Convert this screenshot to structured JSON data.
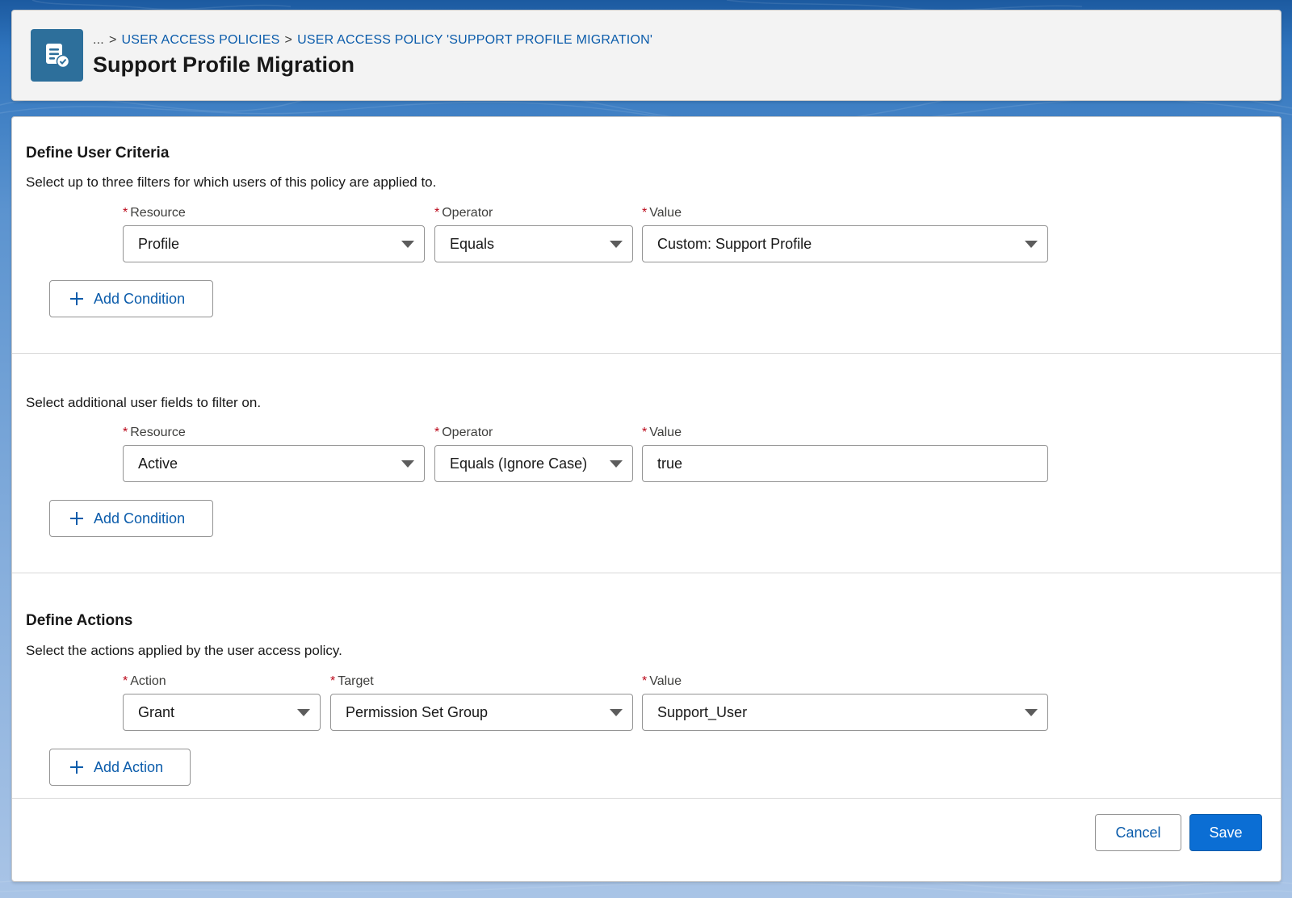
{
  "breadcrumb": {
    "ellipsis": "...",
    "separator": ">",
    "items": [
      "USER ACCESS POLICIES",
      "USER ACCESS POLICY 'SUPPORT PROFILE MIGRATION'"
    ]
  },
  "page_title": "Support Profile Migration",
  "icons": {
    "header": "policy-record-icon",
    "add": "plus-icon",
    "dropdown": "caret-down-icon"
  },
  "colors": {
    "brand": "#0b6ed4",
    "link": "#0b5cab",
    "required": "#ba0517",
    "header_icon_bg": "#2d6f9b"
  },
  "user_criteria": {
    "title": "Define User Criteria",
    "help": "Select up to three filters for which users of this policy are applied to.",
    "required_marker": "*",
    "labels": {
      "resource": "Resource",
      "operator": "Operator",
      "value": "Value"
    },
    "resource": "Profile",
    "operator": "Equals",
    "value": "Custom: Support Profile",
    "add_button": "Add Condition"
  },
  "additional_fields": {
    "help": "Select additional user fields to filter on.",
    "labels": {
      "resource": "Resource",
      "operator": "Operator",
      "value": "Value"
    },
    "resource": "Active",
    "operator": "Equals (Ignore Case)",
    "value": "true",
    "add_button": "Add Condition"
  },
  "actions": {
    "title": "Define Actions",
    "help": "Select the actions applied by the user access policy.",
    "labels": {
      "action": "Action",
      "target": "Target",
      "value": "Value"
    },
    "action": "Grant",
    "target": "Permission Set Group",
    "value": "Support_User",
    "add_button": "Add Action"
  },
  "footer": {
    "cancel": "Cancel",
    "save": "Save"
  }
}
